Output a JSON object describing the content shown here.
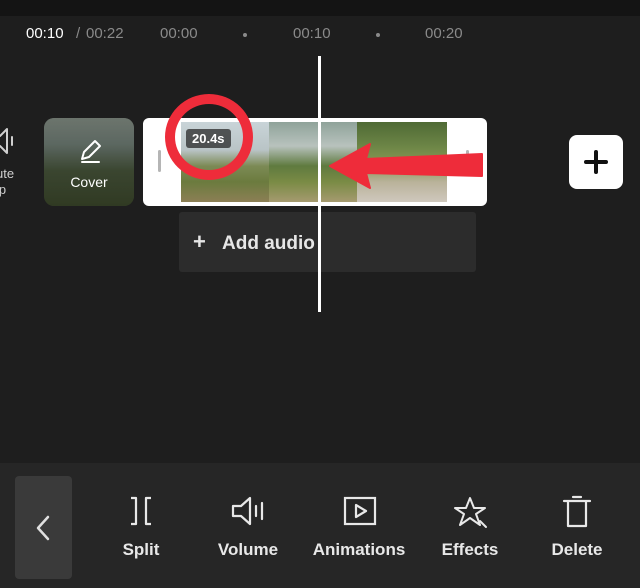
{
  "timeline": {
    "current_time": "00:10",
    "separator": "/",
    "total_time": "00:22",
    "ticks": [
      "00:00",
      "00:10",
      "00:20"
    ]
  },
  "mute_clip": {
    "label_line1": "ute",
    "label_line2": "ip"
  },
  "cover": {
    "label": "Cover"
  },
  "video_clip": {
    "duration": "20.4s"
  },
  "add_audio": {
    "plus": "+",
    "label": "Add audio"
  },
  "toolbar": {
    "items": [
      {
        "label": "Split",
        "icon": "split-icon"
      },
      {
        "label": "Volume",
        "icon": "volume-icon"
      },
      {
        "label": "Animations",
        "icon": "animations-icon"
      },
      {
        "label": "Effects",
        "icon": "effects-icon"
      },
      {
        "label": "Delete",
        "icon": "delete-icon"
      }
    ]
  },
  "colors": {
    "background": "#1e1e1e",
    "annotation_red": "#ee2c3a",
    "toolbar_bg": "#262626"
  }
}
